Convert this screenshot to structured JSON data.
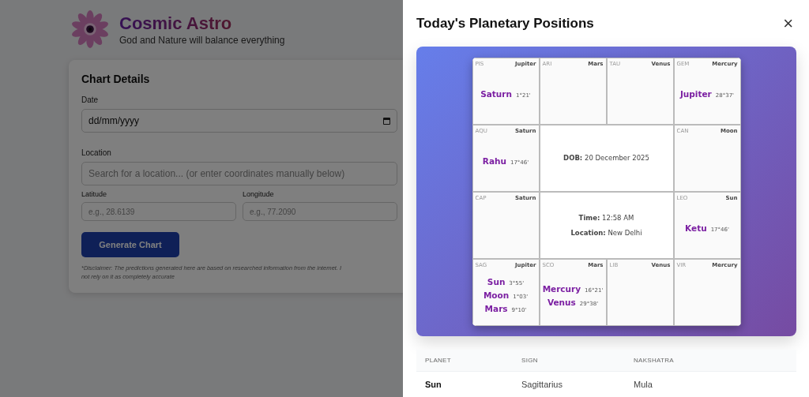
{
  "brand": {
    "title": "Cosmic Astro",
    "tagline": "God and Nature will balance everything"
  },
  "form": {
    "title": "Chart Details",
    "date_label": "Date",
    "date_value": "dd/mm/yyyy",
    "location_label": "Location",
    "location_placeholder": "Search for a location... (or enter coordinates manually below)",
    "latitude_label": "Latitude",
    "latitude_placeholder": "e.g., 28.6139",
    "longitude_label": "Longitude",
    "longitude_placeholder": "e.g., 77.2090",
    "button": "Generate Chart",
    "disclaimer_lines": [
      "*Disclaimer: The predictions generated here are based on researched information from the internet. I",
      "not rely on it as completely accurate"
    ]
  },
  "modal": {
    "title": "Today's Planetary Positions",
    "close": "×",
    "chart": {
      "houses": [
        {
          "sign": "PIS",
          "lord": "Jupiter",
          "planets": [
            {
              "name": "Saturn",
              "degree": "1°21'"
            }
          ]
        },
        {
          "sign": "ARI",
          "lord": "Mars"
        },
        {
          "sign": "TAU",
          "lord": "Venus"
        },
        {
          "sign": "GEM",
          "lord": "Mercury",
          "planets": [
            {
              "name": "Jupiter",
              "degree": "28°37'"
            }
          ]
        },
        {
          "sign": "AQU",
          "lord": "Saturn",
          "planets": [
            {
              "name": "Rahu",
              "degree": "17°46'"
            }
          ]
        },
        {
          "sign": "CAN",
          "lord": "Moon"
        },
        {
          "sign": "CAP",
          "lord": "Saturn"
        },
        {
          "sign": "LEO",
          "lord": "Sun",
          "planets": [
            {
              "name": "Ketu",
              "degree": "17°46'"
            }
          ]
        },
        {
          "sign": "SAG",
          "lord": "Jupiter",
          "planets": [
            {
              "name": "Sun",
              "degree": "3°55'"
            },
            {
              "name": "Moon",
              "degree": "1°03'"
            },
            {
              "name": "Mars",
              "degree": "9°10'"
            }
          ]
        },
        {
          "sign": "SCO",
          "lord": "Mars",
          "planets": [
            {
              "name": "Mercury",
              "degree": "16°21'"
            },
            {
              "name": "Venus",
              "degree": "29°38'"
            }
          ]
        },
        {
          "sign": "LIB",
          "lord": "Venus"
        },
        {
          "sign": "VIR",
          "lord": "Mercury"
        }
      ],
      "center": [
        {
          "label": "DOB:",
          "value": "20 December 2025"
        },
        {
          "label": "Time:",
          "value": "12:58 AM"
        },
        {
          "label": "Location:",
          "value": "New Delhi"
        }
      ]
    },
    "table": {
      "columns": [
        "PLANET",
        "SIGN",
        "NAKSHATRA"
      ],
      "rows": [
        [
          "Sun",
          "Sagittarius",
          "Mula"
        ]
      ]
    }
  }
}
